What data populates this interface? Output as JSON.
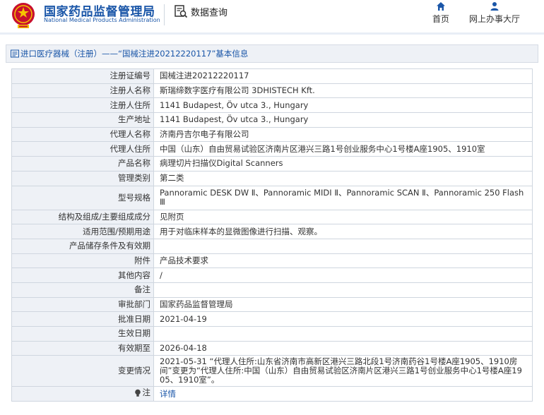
{
  "header": {
    "org_name_cn": "国家药品监督管理局",
    "org_name_en": "National Medical Products Administration",
    "data_query": "数据查询",
    "nav": [
      {
        "label": "首页",
        "icon": "home-icon"
      },
      {
        "label": "网上办事大厅",
        "icon": "user-icon"
      }
    ]
  },
  "breadcrumb": {
    "text": "进口医疗器械（注册）——“国械注进20212220117”基本信息"
  },
  "colors": {
    "brand_blue": "#1a56a8",
    "label_bg": "#eef1f6",
    "border": "#cfd6df"
  },
  "rows": [
    {
      "label": "注册证编号",
      "value": "国械注进20212220117"
    },
    {
      "label": "注册人名称",
      "value": "斯瑞缔数字医疗有限公司 3DHISTECH Kft."
    },
    {
      "label": "注册人住所",
      "value": "1141 Budapest, Öv utca 3., Hungary"
    },
    {
      "label": "生产地址",
      "value": "1141 Budapest, Öv utca 3., Hungary"
    },
    {
      "label": "代理人名称",
      "value": "济南丹吉尔电子有限公司"
    },
    {
      "label": "代理人住所",
      "value": "中国（山东）自由贸易试验区济南片区港兴三路1号创业服务中心1号楼A座1905、1910室"
    },
    {
      "label": "产品名称",
      "value": "病理切片扫描仪Digital Scanners"
    },
    {
      "label": "管理类别",
      "value": "第二类"
    },
    {
      "label": "型号规格",
      "value": "Pannoramic DESK DW Ⅱ、Pannoramic MIDI Ⅱ、Pannoramic SCAN Ⅱ、Pannoramic 250 Flash Ⅲ"
    },
    {
      "label": "结构及组成/主要组成成分",
      "value": "见附页"
    },
    {
      "label": "适用范围/预期用途",
      "value": "用于对临床样本的显微图像进行扫描、观察。"
    },
    {
      "label": "产品储存条件及有效期",
      "value": ""
    },
    {
      "label": "附件",
      "value": "产品技术要求"
    },
    {
      "label": "其他内容",
      "value": "/"
    },
    {
      "label": "备注",
      "value": ""
    },
    {
      "label": "审批部门",
      "value": "国家药品监督管理局"
    },
    {
      "label": "批准日期",
      "value": "2021-04-19"
    },
    {
      "label": "生效日期",
      "value": ""
    },
    {
      "label": "有效期至",
      "value": "2026-04-18"
    },
    {
      "label": "变更情况",
      "value": "2021-05-31 “代理人住所:山东省济南市高新区港兴三路北段1号济南药谷1号楼A座1905、1910房间”变更为“代理人住所:中国（山东）自由贸易试验区济南片区港兴三路1号创业服务中心1号楼A座1905、1910室”。"
    },
    {
      "label": "注",
      "value": "详情"
    }
  ]
}
